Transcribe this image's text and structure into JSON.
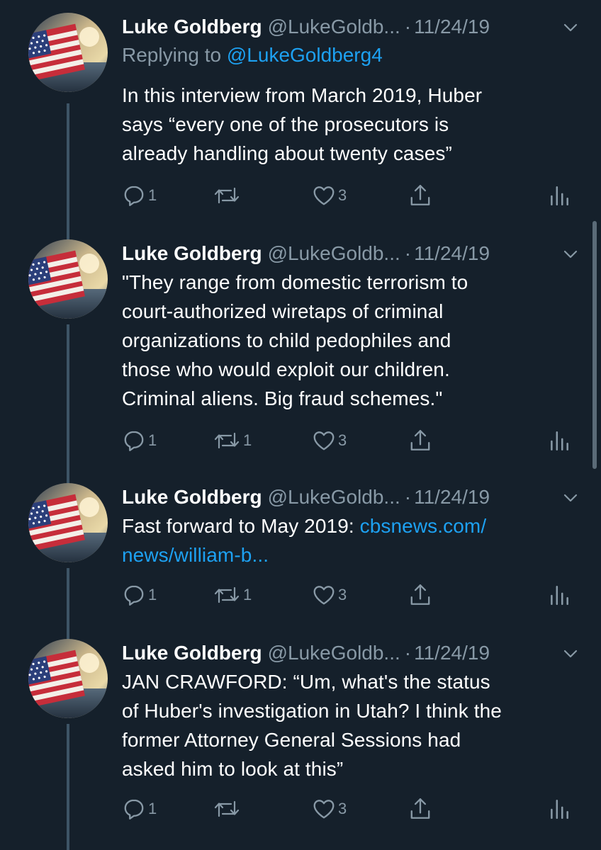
{
  "tweets": [
    {
      "name": "Luke Goldberg",
      "handle": "@LukeGoldb...",
      "dot": "·",
      "date": "11/24/19",
      "replying_prefix": "Replying to ",
      "replying_to": "@LukeGoldberg4",
      "text_lines": [
        "In this interview from March 2019, Huber",
        "says “every one of the prosecutors is",
        "already handling about twenty cases”"
      ],
      "replies": "1",
      "retweets": "",
      "likes": "3"
    },
    {
      "name": "Luke Goldberg",
      "handle": "@LukeGoldb...",
      "dot": "·",
      "date": "11/24/19",
      "text_lines": [
        "\"They range from domestic terrorism to",
        "court-authorized wiretaps of criminal",
        "organizations to child pedophiles and",
        "those who would exploit our children.",
        "Criminal aliens. Big fraud schemes.\""
      ],
      "replies": "1",
      "retweets": "1",
      "likes": "3"
    },
    {
      "name": "Luke Goldberg",
      "handle": "@LukeGoldb...",
      "dot": "·",
      "date": "11/24/19",
      "text_prefix": "Fast forward to May 2019: ",
      "link_part1": "cbsnews.com/",
      "link_part2": "news/william-b...",
      "replies": "1",
      "retweets": "1",
      "likes": "3"
    },
    {
      "name": "Luke Goldberg",
      "handle": "@LukeGoldb...",
      "dot": "·",
      "date": "11/24/19",
      "text_lines": [
        "JAN CRAWFORD: “Um, what's the status",
        "of Huber's investigation in Utah? I think the",
        "former Attorney General Sessions had",
        "asked him to look at this”"
      ],
      "replies": "1",
      "retweets": "",
      "likes": "3"
    }
  ],
  "icons": {
    "reply": "reply-icon",
    "retweet": "retweet-icon",
    "like": "heart-icon",
    "share": "share-icon",
    "analytics": "analytics-icon",
    "caret": "chevron-down-icon"
  },
  "colors": {
    "background": "#15202b",
    "secondary_text": "#8899a6",
    "link": "#1da1f2",
    "thread_line": "#3d5466"
  }
}
